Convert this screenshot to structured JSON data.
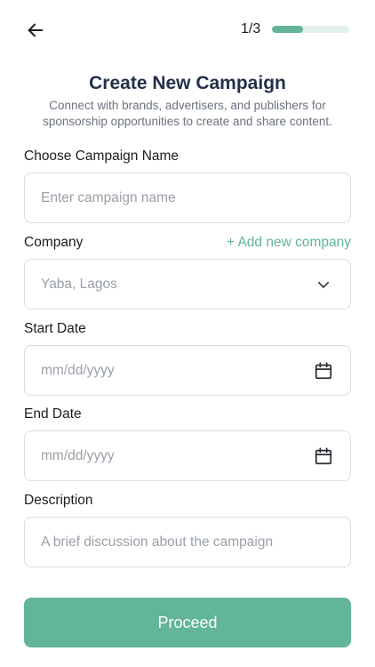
{
  "header": {
    "step_text": "1/3",
    "progress_fraction": 0.4
  },
  "title": "Create New Campaign",
  "subtitle": "Connect with brands, advertisers, and publishers for sponsorship opportunities to create and share content.",
  "form": {
    "campaign_name": {
      "label": "Choose Campaign Name",
      "placeholder": "Enter campaign name"
    },
    "company": {
      "label": "Company",
      "add_link": "+ Add new company",
      "selected": "Yaba, Lagos"
    },
    "start_date": {
      "label": "Start Date",
      "placeholder": "mm/dd/yyyy"
    },
    "end_date": {
      "label": "End Date",
      "placeholder": "mm/dd/yyyy"
    },
    "description": {
      "label": "Description",
      "placeholder": "A brief discussion about the campaign"
    }
  },
  "proceed_label": "Proceed",
  "colors": {
    "accent": "#62b49a",
    "title": "#24304a",
    "border": "#d9dde2"
  },
  "icons": {
    "back": "arrow-left-icon",
    "dropdown": "chevron-down-icon",
    "calendar": "calendar-icon"
  }
}
